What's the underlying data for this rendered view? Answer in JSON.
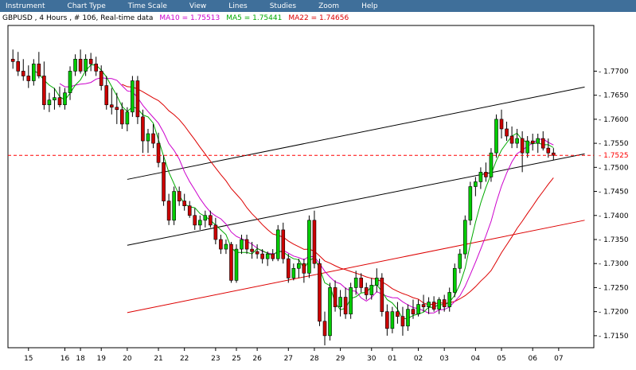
{
  "menu": [
    "Instrument",
    "Chart Type",
    "Time Scale",
    "View",
    "Lines",
    "Studies",
    "Zoom",
    "Help"
  ],
  "chart_data": {
    "type": "candlestick",
    "title": "GBPUSD , 4 Hours , # 106, Real-time data",
    "indicators": [
      {
        "name": "MA10",
        "value_label": "MA10 = 1.75513",
        "color": "#cc00cc"
      },
      {
        "name": "MA5",
        "value_label": "MA5 = 1.75441",
        "color": "#00aa00"
      },
      {
        "name": "MA22",
        "value_label": "MA22 = 1.74656",
        "color": "#dd0000"
      }
    ],
    "price_label": "1.7525",
    "current_price": 1.7525,
    "ylim": [
      1.7125,
      1.7795
    ],
    "y_ticks": [
      "1.7700",
      "1.7650",
      "1.7600",
      "1.7550",
      "1.7500",
      "1.7450",
      "1.7400",
      "1.7350",
      "1.7300",
      "1.7250",
      "1.7200",
      "1.7150"
    ],
    "x_ticks": [
      {
        "label": "15",
        "bar": 3
      },
      {
        "label": "16",
        "bar": 10
      },
      {
        "label": "18",
        "bar": 13
      },
      {
        "label": "19",
        "bar": 17
      },
      {
        "label": "20",
        "bar": 22
      },
      {
        "label": "21",
        "bar": 28
      },
      {
        "label": "22",
        "bar": 33
      },
      {
        "label": "23",
        "bar": 39
      },
      {
        "label": "25",
        "bar": 43
      },
      {
        "label": "26",
        "bar": 47
      },
      {
        "label": "27",
        "bar": 53
      },
      {
        "label": "28",
        "bar": 58
      },
      {
        "label": "29",
        "bar": 63
      },
      {
        "label": "30",
        "bar": 69
      },
      {
        "label": "01",
        "bar": 73
      },
      {
        "label": "02",
        "bar": 78
      },
      {
        "label": "03",
        "bar": 83
      },
      {
        "label": "04",
        "bar": 89
      },
      {
        "label": "05",
        "bar": 94
      },
      {
        "label": "06",
        "bar": 100
      },
      {
        "label": "07",
        "bar": 105
      }
    ],
    "candles": [
      [
        1.7725,
        1.7745,
        1.7705,
        1.772
      ],
      [
        1.772,
        1.774,
        1.769,
        1.77
      ],
      [
        1.77,
        1.7725,
        1.768,
        1.769
      ],
      [
        1.769,
        1.7712,
        1.7665,
        1.768
      ],
      [
        1.768,
        1.7725,
        1.767,
        1.7715
      ],
      [
        1.7715,
        1.774,
        1.7685,
        1.769
      ],
      [
        1.769,
        1.772,
        1.762,
        1.763
      ],
      [
        1.763,
        1.7655,
        1.7615,
        1.764
      ],
      [
        1.764,
        1.7665,
        1.762,
        1.7645
      ],
      [
        1.7645,
        1.7668,
        1.7625,
        1.763
      ],
      [
        1.763,
        1.7665,
        1.762,
        1.7655
      ],
      [
        1.7655,
        1.771,
        1.764,
        1.77
      ],
      [
        1.77,
        1.7735,
        1.769,
        1.7725
      ],
      [
        1.7725,
        1.7745,
        1.7695,
        1.77
      ],
      [
        1.77,
        1.7735,
        1.769,
        1.7725
      ],
      [
        1.7725,
        1.7738,
        1.77,
        1.7715
      ],
      [
        1.7715,
        1.773,
        1.769,
        1.77
      ],
      [
        1.77,
        1.7712,
        1.766,
        1.767
      ],
      [
        1.767,
        1.769,
        1.762,
        1.763
      ],
      [
        1.763,
        1.7665,
        1.761,
        1.7625
      ],
      [
        1.7625,
        1.7655,
        1.759,
        1.762
      ],
      [
        1.762,
        1.7635,
        1.758,
        1.759
      ],
      [
        1.759,
        1.7625,
        1.7575,
        1.7615
      ],
      [
        1.7615,
        1.769,
        1.7605,
        1.768
      ],
      [
        1.768,
        1.769,
        1.759,
        1.7605
      ],
      [
        1.7605,
        1.762,
        1.753,
        1.7555
      ],
      [
        1.7555,
        1.758,
        1.753,
        1.757
      ],
      [
        1.757,
        1.759,
        1.754,
        1.755
      ],
      [
        1.755,
        1.7572,
        1.75,
        1.751
      ],
      [
        1.751,
        1.7525,
        1.742,
        1.743
      ],
      [
        1.743,
        1.7445,
        1.738,
        1.739
      ],
      [
        1.739,
        1.746,
        1.738,
        1.745
      ],
      [
        1.745,
        1.746,
        1.742,
        1.743
      ],
      [
        1.743,
        1.7445,
        1.741,
        1.742
      ],
      [
        1.742,
        1.743,
        1.7395,
        1.74
      ],
      [
        1.74,
        1.7415,
        1.737,
        1.738
      ],
      [
        1.738,
        1.74,
        1.737,
        1.739
      ],
      [
        1.739,
        1.741,
        1.7375,
        1.74
      ],
      [
        1.74,
        1.741,
        1.7375,
        1.738
      ],
      [
        1.738,
        1.7395,
        1.734,
        1.735
      ],
      [
        1.735,
        1.736,
        1.732,
        1.733
      ],
      [
        1.733,
        1.735,
        1.732,
        1.734
      ],
      [
        1.734,
        1.7345,
        1.726,
        1.7265
      ],
      [
        1.7265,
        1.734,
        1.726,
        1.733
      ],
      [
        1.733,
        1.736,
        1.732,
        1.735
      ],
      [
        1.735,
        1.736,
        1.732,
        1.733
      ],
      [
        1.733,
        1.7345,
        1.731,
        1.7325
      ],
      [
        1.7325,
        1.734,
        1.731,
        1.732
      ],
      [
        1.732,
        1.733,
        1.73,
        1.731
      ],
      [
        1.731,
        1.7325,
        1.7295,
        1.732
      ],
      [
        1.732,
        1.733,
        1.7305,
        1.731
      ],
      [
        1.731,
        1.738,
        1.7305,
        1.737
      ],
      [
        1.737,
        1.7385,
        1.73,
        1.731
      ],
      [
        1.731,
        1.732,
        1.726,
        1.727
      ],
      [
        1.727,
        1.73,
        1.7265,
        1.729
      ],
      [
        1.729,
        1.731,
        1.727,
        1.73
      ],
      [
        1.73,
        1.731,
        1.726,
        1.728
      ],
      [
        1.728,
        1.74,
        1.727,
        1.739
      ],
      [
        1.739,
        1.741,
        1.729,
        1.73
      ],
      [
        1.73,
        1.731,
        1.717,
        1.718
      ],
      [
        1.718,
        1.72,
        1.713,
        1.715
      ],
      [
        1.715,
        1.726,
        1.714,
        1.725
      ],
      [
        1.725,
        1.7265,
        1.72,
        1.721
      ],
      [
        1.721,
        1.7245,
        1.719,
        1.723
      ],
      [
        1.723,
        1.725,
        1.7185,
        1.7195
      ],
      [
        1.7195,
        1.726,
        1.7185,
        1.725
      ],
      [
        1.725,
        1.7285,
        1.7235,
        1.727
      ],
      [
        1.727,
        1.728,
        1.724,
        1.725
      ],
      [
        1.725,
        1.726,
        1.7225,
        1.7235
      ],
      [
        1.7235,
        1.727,
        1.7225,
        1.7255
      ],
      [
        1.7255,
        1.729,
        1.724,
        1.727
      ],
      [
        1.727,
        1.728,
        1.719,
        1.72
      ],
      [
        1.72,
        1.7215,
        1.715,
        1.7165
      ],
      [
        1.7165,
        1.721,
        1.7155,
        1.72
      ],
      [
        1.72,
        1.722,
        1.7175,
        1.719
      ],
      [
        1.719,
        1.721,
        1.715,
        1.717
      ],
      [
        1.717,
        1.7215,
        1.716,
        1.7205
      ],
      [
        1.7205,
        1.7225,
        1.7185,
        1.7195
      ],
      [
        1.7195,
        1.7225,
        1.719,
        1.7215
      ],
      [
        1.7215,
        1.7235,
        1.72,
        1.721
      ],
      [
        1.721,
        1.723,
        1.7195,
        1.722
      ],
      [
        1.722,
        1.7232,
        1.72,
        1.7205
      ],
      [
        1.7205,
        1.723,
        1.7195,
        1.7225
      ],
      [
        1.7225,
        1.7235,
        1.72,
        1.721
      ],
      [
        1.721,
        1.725,
        1.72,
        1.724
      ],
      [
        1.724,
        1.73,
        1.723,
        1.729
      ],
      [
        1.729,
        1.733,
        1.728,
        1.732
      ],
      [
        1.732,
        1.74,
        1.731,
        1.739
      ],
      [
        1.739,
        1.747,
        1.738,
        1.746
      ],
      [
        1.746,
        1.748,
        1.744,
        1.747
      ],
      [
        1.747,
        1.75,
        1.7455,
        1.749
      ],
      [
        1.749,
        1.751,
        1.747,
        1.748
      ],
      [
        1.748,
        1.754,
        1.747,
        1.753
      ],
      [
        1.753,
        1.761,
        1.752,
        1.76
      ],
      [
        1.76,
        1.762,
        1.756,
        1.758
      ],
      [
        1.758,
        1.7595,
        1.7555,
        1.7565
      ],
      [
        1.7565,
        1.7585,
        1.754,
        1.755
      ],
      [
        1.755,
        1.758,
        1.754,
        1.756
      ],
      [
        1.756,
        1.7575,
        1.749,
        1.753
      ],
      [
        1.753,
        1.7565,
        1.752,
        1.7555
      ],
      [
        1.7555,
        1.757,
        1.7535,
        1.755
      ],
      [
        1.755,
        1.757,
        1.753,
        1.756
      ],
      [
        1.756,
        1.7575,
        1.7535,
        1.754
      ],
      [
        1.754,
        1.756,
        1.752,
        1.753
      ],
      [
        1.753,
        1.754,
        1.7515,
        1.7525
      ]
    ],
    "trend_lines": [
      {
        "color": "#000000",
        "start": [
          22,
          1.7475
        ],
        "end": [
          110,
          1.7667
        ]
      },
      {
        "color": "#000000",
        "start": [
          22,
          1.7338
        ],
        "end": [
          110,
          1.7528
        ]
      },
      {
        "color": "#dd0000",
        "start": [
          22,
          1.7198
        ],
        "end": [
          110,
          1.739
        ]
      }
    ]
  }
}
